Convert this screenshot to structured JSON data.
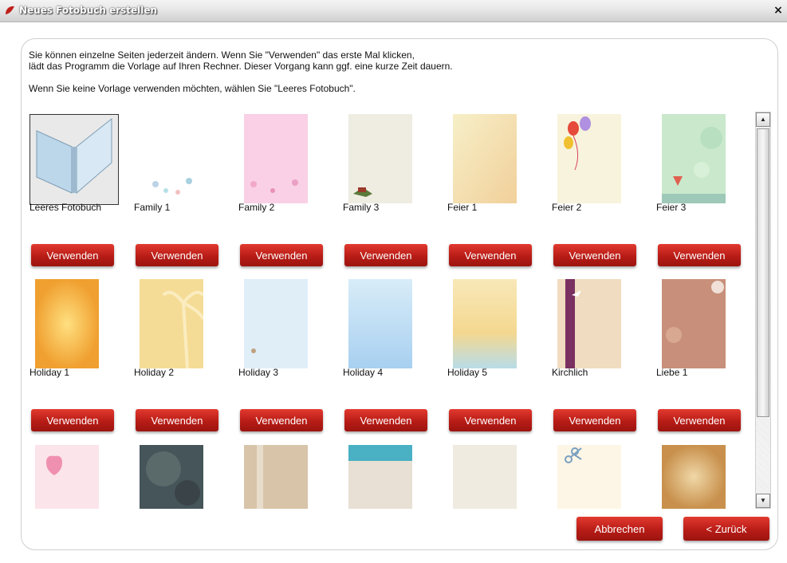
{
  "window": {
    "title": "Neues Fotobuch erstellen",
    "close_label": "×"
  },
  "intro": {
    "line1": "Sie können einzelne Seiten jederzeit ändern. Wenn Sie \"Verwenden\" das erste Mal klicken,",
    "line2": "lädt das Programm die Vorlage auf Ihren Rechner. Dieser Vorgang kann ggf. eine kurze Zeit dauern.",
    "line3": "Wenn Sie keine Vorlage verwenden möchten, wählen Sie \"Leeres Fotobuch\"."
  },
  "use_label": "Verwenden",
  "templates": [
    {
      "name": "Leeres Fotobuch",
      "preview": "book"
    },
    {
      "name": "Family 1",
      "preview": "family1"
    },
    {
      "name": "Family 2",
      "preview": "family2"
    },
    {
      "name": "Family 3",
      "preview": "family3"
    },
    {
      "name": "Feier 1",
      "preview": "feier1"
    },
    {
      "name": "Feier 2",
      "preview": "feier2"
    },
    {
      "name": "Feier 3",
      "preview": "feier3"
    },
    {
      "name": "Holiday 1",
      "preview": "holiday1"
    },
    {
      "name": "Holiday 2",
      "preview": "holiday2"
    },
    {
      "name": "Holiday 3",
      "preview": "holiday3"
    },
    {
      "name": "Holiday 4",
      "preview": "holiday4"
    },
    {
      "name": "Holiday 5",
      "preview": "holiday5"
    },
    {
      "name": "Kirchlich",
      "preview": "kirchlich"
    },
    {
      "name": "Liebe 1",
      "preview": "liebe1"
    },
    {
      "name": "",
      "preview": "pinkheart"
    },
    {
      "name": "",
      "preview": "stone"
    },
    {
      "name": "",
      "preview": "sand"
    },
    {
      "name": "",
      "preview": "beach"
    },
    {
      "name": "",
      "preview": "paper"
    },
    {
      "name": "",
      "preview": "scissors"
    },
    {
      "name": "",
      "preview": "oldpaper"
    }
  ],
  "footer": {
    "cancel_label": "Abbrechen",
    "back_label": "< Zurück"
  },
  "colors": {
    "accent": "#c0201a",
    "panel_border": "#cfcfcf"
  }
}
